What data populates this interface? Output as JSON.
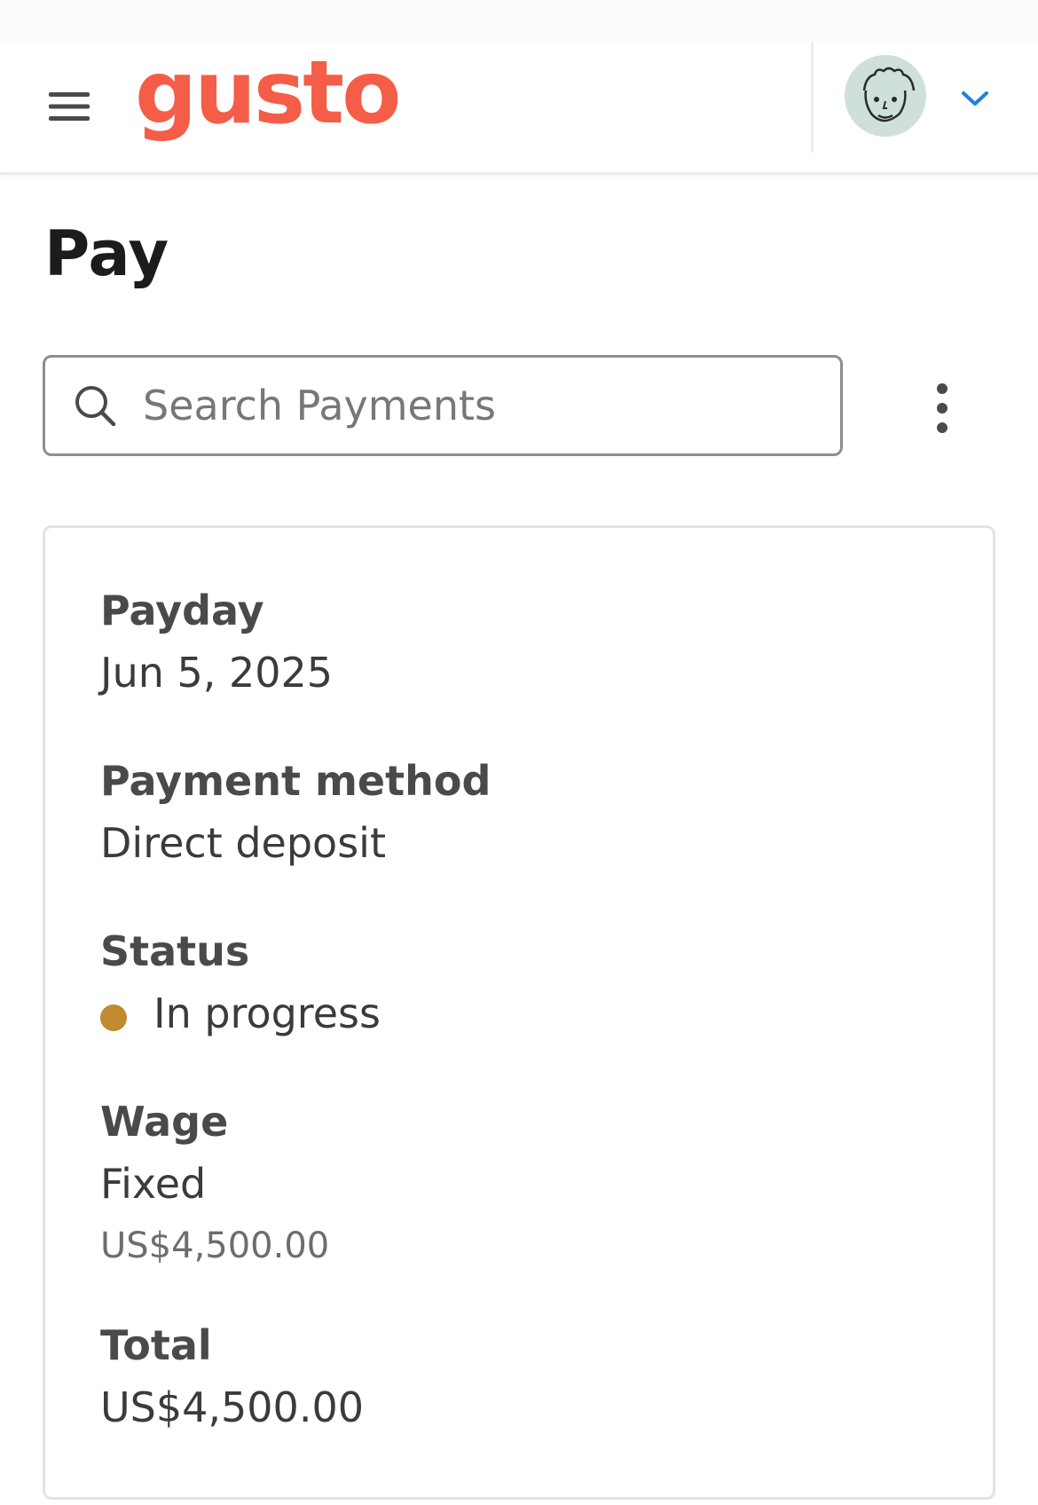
{
  "header": {
    "logo_text": "gusto",
    "menu_icon": "hamburger-menu-icon",
    "avatar_icon": "avatar-illustration",
    "chevron_icon": "chevron-down-icon",
    "brand_color": "#f45d48",
    "chevron_color": "#1f7fe0"
  },
  "page": {
    "title": "Pay"
  },
  "search": {
    "placeholder": "Search Payments",
    "value": "",
    "icon": "search-icon"
  },
  "more_menu": {
    "icon": "vertical-dots-icon"
  },
  "payment": {
    "payday_label": "Payday",
    "payday_value": "Jun 5, 2025",
    "method_label": "Payment method",
    "method_value": "Direct deposit",
    "status_label": "Status",
    "status_value": "In progress",
    "status_color": "#c08a2e",
    "wage_label": "Wage",
    "wage_type": "Fixed",
    "wage_amount": "US$4,500.00",
    "total_label": "Total",
    "total_value": "US$4,500.00"
  }
}
